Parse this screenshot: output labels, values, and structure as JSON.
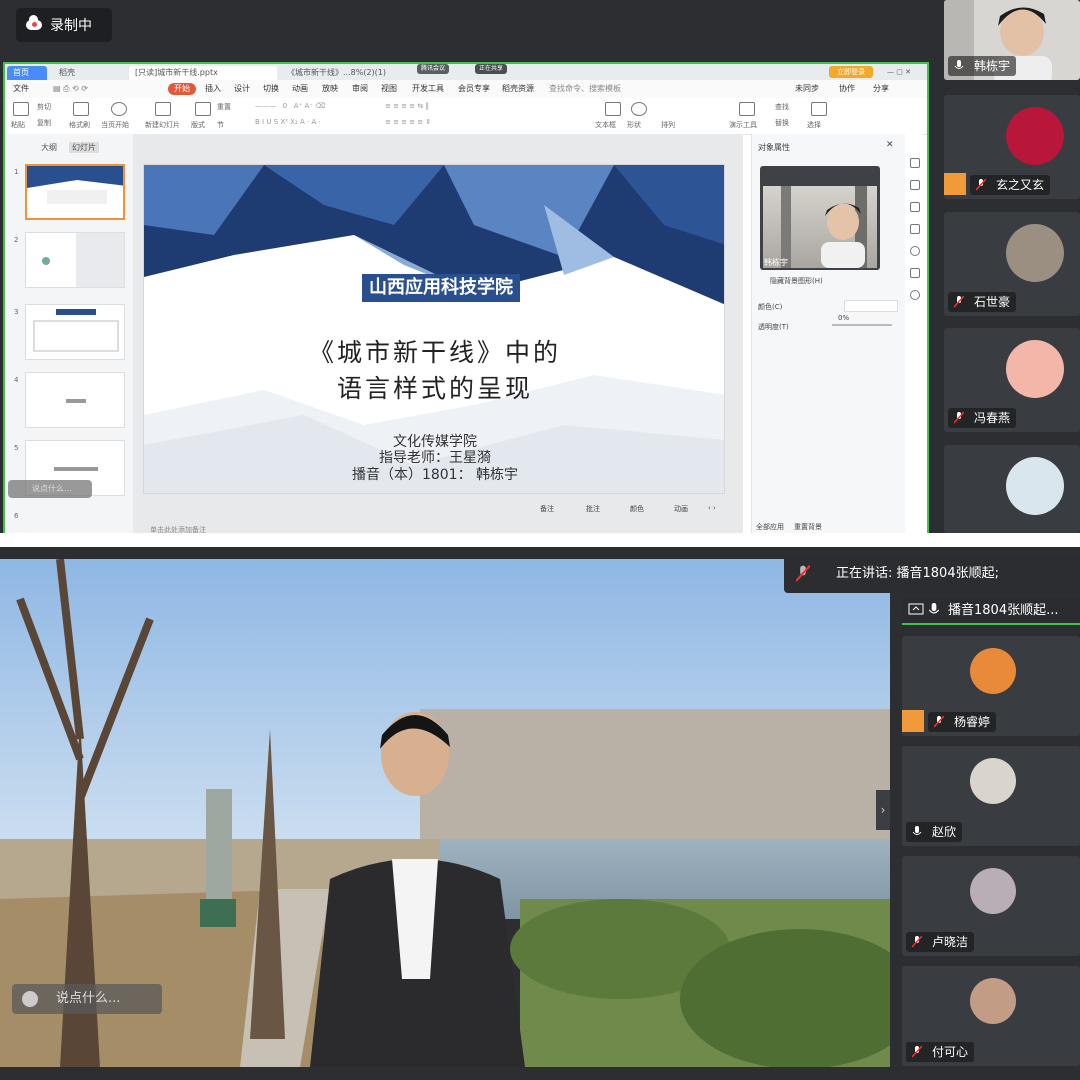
{
  "recording": {
    "label": "录制中"
  },
  "wps": {
    "tabs": [
      "首页",
      "稻壳",
      "[只读]城市新干线.pptx",
      "《城市新干线》...8%(2)(1)"
    ],
    "share_pill": "腾讯会议",
    "share_pill2": "正在共享",
    "badge": "立即登录",
    "menu": [
      "文件",
      "开始",
      "插入",
      "设计",
      "切换",
      "动画",
      "放映",
      "审阅",
      "视图",
      "开发工具",
      "会员专享",
      "稻壳资源",
      "查找命令、搜索模板",
      "未同步",
      "协作",
      "分享"
    ],
    "ribbon": [
      "粘贴",
      "剪切",
      "复制",
      "格式刷",
      "当页开始",
      "新建幻灯片",
      "版式",
      "节",
      "重置",
      "文本框",
      "形状",
      "排列",
      "演示工具",
      "查找",
      "替换",
      "选择"
    ],
    "left_tabs": [
      "大纲",
      "幻灯片"
    ],
    "thumb_numbers": [
      "1",
      "2",
      "3",
      "4",
      "5",
      "6"
    ],
    "slide": {
      "school": "山西应用科技学院",
      "title_line1": "《城市新干线》中的",
      "title_line2": "语言样式的呈现",
      "dept": "文化传媒学院",
      "advisor": "指导老师：王星漪",
      "student": "播音（本）1801： 韩栋宇"
    },
    "slide_footer": [
      "备注",
      "批注",
      "颜色",
      "动画"
    ],
    "notes_hint": "单击此处添加备注",
    "right_pane": {
      "title": "对象属性",
      "pip_name": "韩栋宇",
      "fill_label": "颜色(C)",
      "transparency_label": "透明度(T)",
      "transparency_value": "0%",
      "checkbox_label": "隐藏背景图形(H)",
      "bottom_tabs": [
        "全部应用",
        "重置背景"
      ]
    },
    "chat_placeholder": "说点什么..."
  },
  "participants_top": [
    {
      "name": "韩栋宇",
      "avatar_color": "#8a8580"
    },
    {
      "name": "玄之又玄",
      "avatar_color": "#b8163a",
      "host": true
    },
    {
      "name": "石世豪",
      "avatar_color": "#9a8f80"
    },
    {
      "name": "冯春燕",
      "avatar_color": "#f2b7a8"
    },
    {
      "name": "",
      "avatar_color": "#d9e6ee"
    }
  ],
  "bottom": {
    "chat_placeholder": "说点什么...",
    "speaking": "正在讲话: 播音1804张顺起;",
    "active_speaker": "播音1804张顺起...",
    "participants": [
      {
        "name": "杨睿婷",
        "avatar_color": "#e98a3a",
        "host": true
      },
      {
        "name": "赵欣",
        "avatar_color": "#d9d4cc"
      },
      {
        "name": "卢晓洁",
        "avatar_color": "#b9aeb5"
      },
      {
        "name": "付可心",
        "avatar_color": "#c39c86"
      }
    ]
  },
  "colors": {
    "accent_green": "#3fc24e",
    "host_orange": "#f09a3a",
    "slide_blue": "#2a4f8f",
    "start_red": "#e05a3a"
  }
}
